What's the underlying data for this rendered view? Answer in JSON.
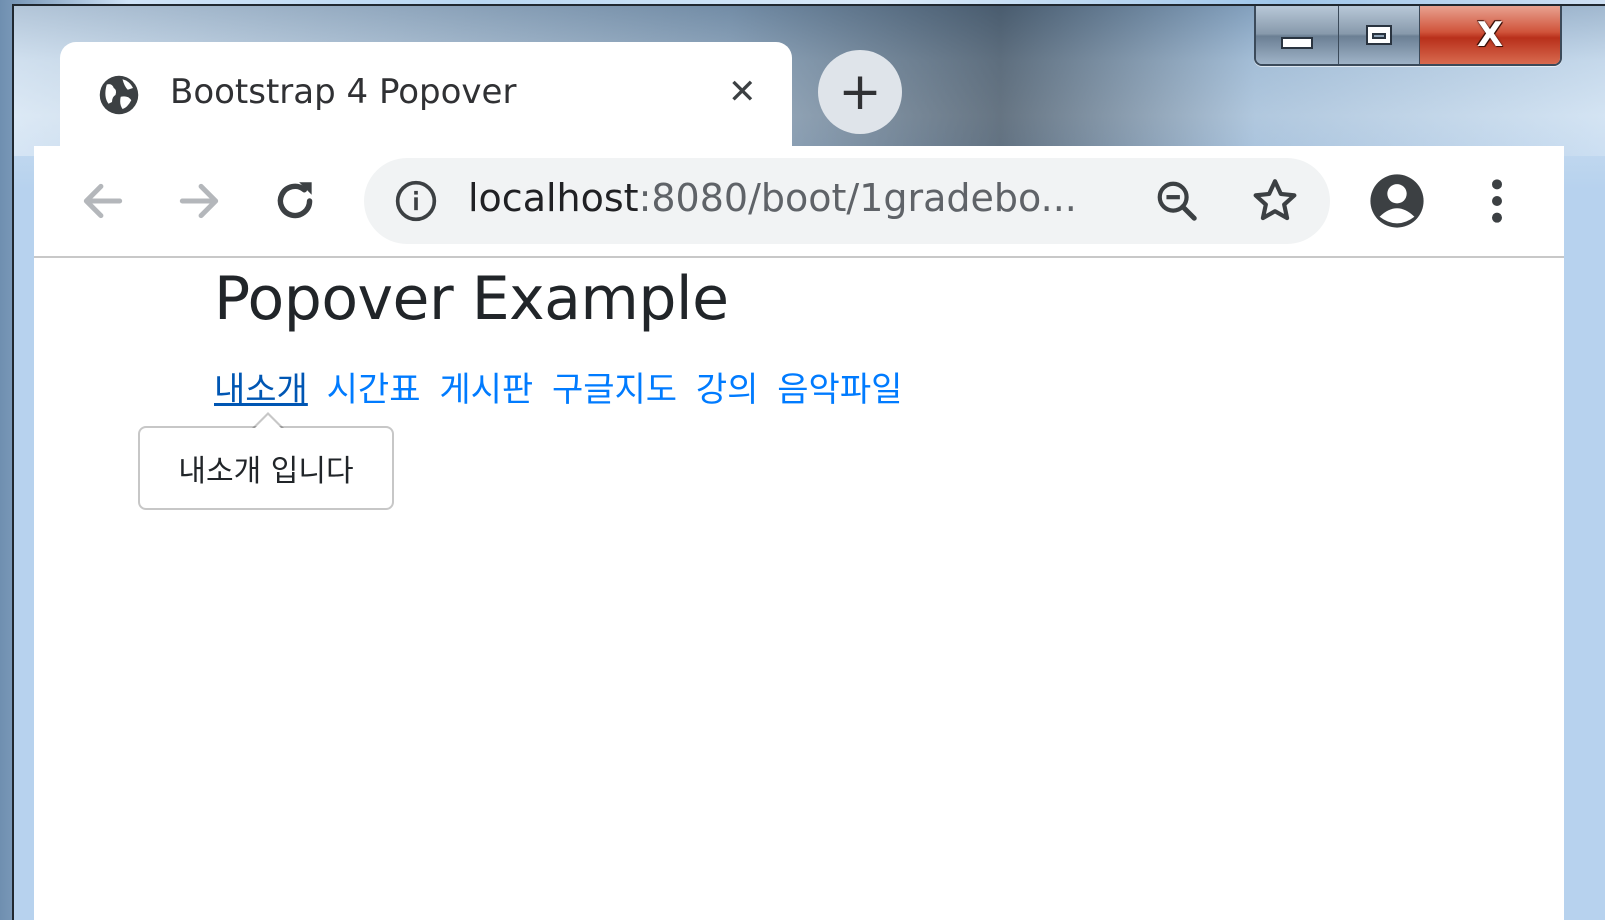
{
  "window": {
    "caption_close": "X"
  },
  "tab": {
    "title": "Bootstrap 4 Popover",
    "close_glyph": "✕",
    "new_tab_glyph": "+"
  },
  "toolbar": {
    "url_host": "localhost",
    "url_rest": ":8080/boot/1gradebo..."
  },
  "page": {
    "title": "Popover Example",
    "links": [
      "내소개",
      "시간표",
      "게시판",
      "구글지도",
      "강의",
      "음악파일"
    ],
    "active_link_index": 0,
    "popover_content": "내소개 입니다"
  },
  "colors": {
    "link": "#007bff",
    "link_active": "#0056b3",
    "heading": "#212529",
    "close_button": "#c8452b"
  },
  "icons": {
    "tab": "globe-icon",
    "back": "arrow-left-icon",
    "forward": "arrow-right-icon",
    "reload": "reload-icon",
    "site_info": "info-icon",
    "zoom": "zoom-out-icon",
    "bookmark": "star-icon",
    "profile": "account-icon",
    "menu": "kebab-menu-icon"
  }
}
